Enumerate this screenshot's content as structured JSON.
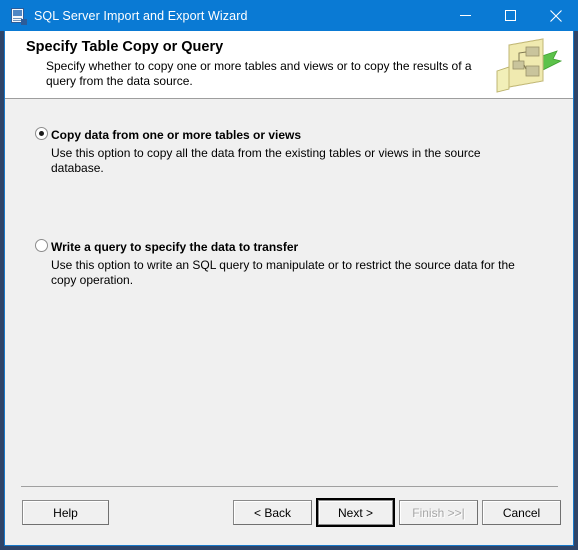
{
  "window": {
    "title": "SQL Server Import and Export Wizard",
    "icon": "wizard-document-icon",
    "controls": {
      "minimize": "minimize-icon",
      "maximize": "maximize-icon",
      "close": "close-icon"
    },
    "colors": {
      "titlebar": "#0a7ad4",
      "frame": "#2e4468",
      "inner_border": "#1878c8",
      "body": "#f0f0f0",
      "header": "#ffffff"
    }
  },
  "header": {
    "title": "Specify Table Copy or Query",
    "description": "Specify whether to copy one or more tables and views or to copy the results of a query from the data source.",
    "art": "table-diagram-arrow-icon"
  },
  "options": [
    {
      "label": "Copy data from one or more tables or views",
      "description": "Use this option to copy all the data from the existing tables or views in the source database.",
      "selected": true
    },
    {
      "label": "Write a query to specify the data to transfer",
      "description": "Use this option to write an SQL query to manipulate or to restrict the source data for the copy operation.",
      "selected": false
    }
  ],
  "footer": {
    "help": "Help",
    "back": "< Back",
    "next": "Next >",
    "finish": "Finish >>|",
    "finish_enabled": false,
    "cancel": "Cancel"
  }
}
